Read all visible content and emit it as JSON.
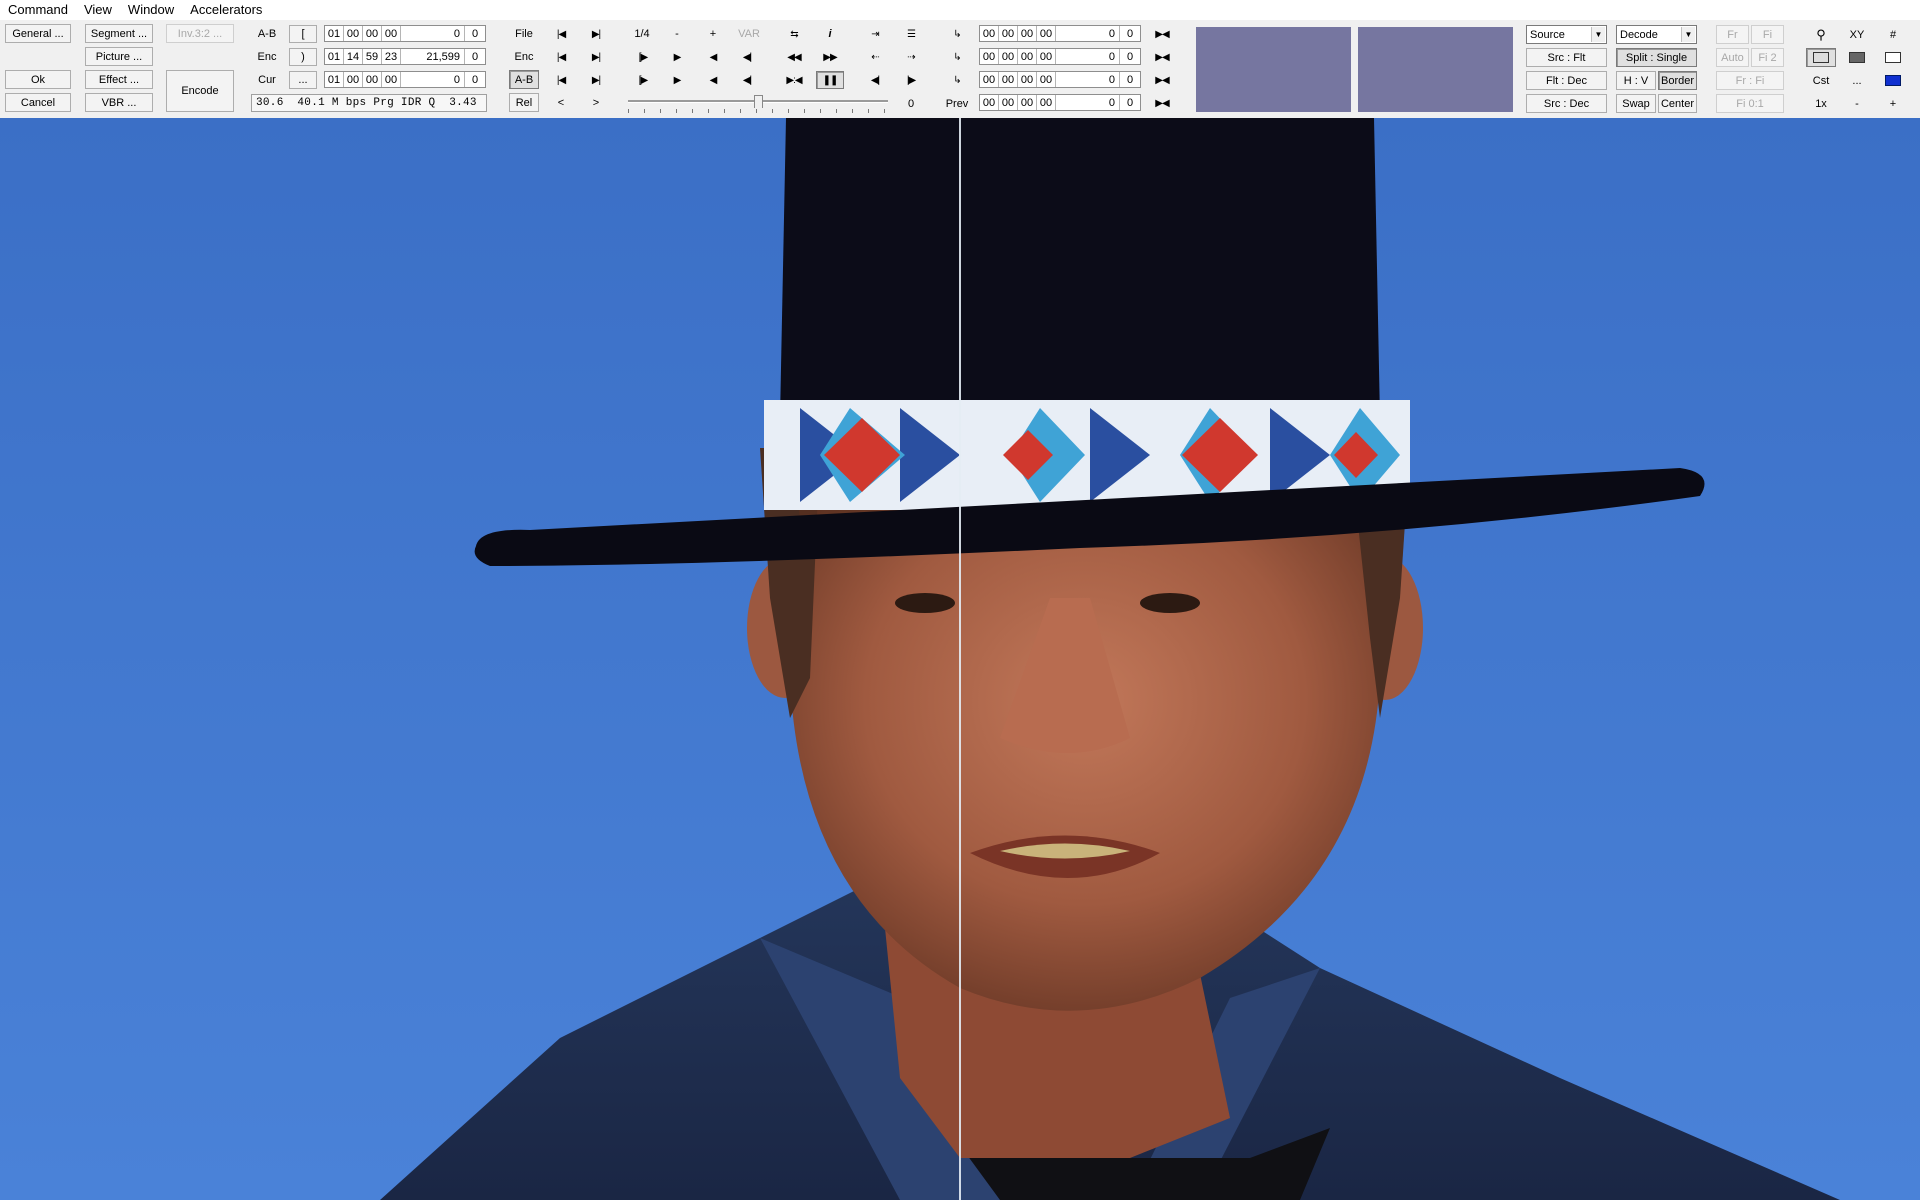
{
  "menu": [
    "Command",
    "View",
    "Window",
    "Accelerators"
  ],
  "left_buttons": {
    "general": "General ...",
    "segment": "Segment ...",
    "inv": "Inv.3:2 ...",
    "picture": "Picture ...",
    "ok": "Ok",
    "effect": "Effect ...",
    "cancel": "Cancel",
    "vbr": "VBR ...",
    "encode": "Encode"
  },
  "range": {
    "ab_label": "A-B",
    "enc_label": "Enc",
    "cur_label": "Cur",
    "mark_in": "[",
    "mark_out": ")",
    "mark_cur": "...",
    "rows": [
      {
        "h": "01",
        "m": "00",
        "s": "00",
        "f": "00",
        "frames": "0",
        "z": "0"
      },
      {
        "h": "01",
        "m": "14",
        "s": "59",
        "f": "23",
        "frames": "21,599",
        "z": "0"
      },
      {
        "h": "01",
        "m": "00",
        "s": "00",
        "f": "00",
        "frames": "0",
        "z": "0"
      }
    ],
    "status": "30.6  40.1 M bps Prg IDR Q  3.43"
  },
  "nav": {
    "file": "File",
    "enc": "Enc",
    "ab": "A-B",
    "rel": "Rel",
    "rel_prev": "<",
    "rel_next": ">",
    "fraction": "1/4",
    "minus": "-",
    "plus": "+",
    "var": "VAR",
    "slider_value": "0",
    "slider_fraction": 0.5
  },
  "right_tc": {
    "prev_label": "Prev",
    "rows": [
      {
        "h": "00",
        "m": "00",
        "s": "00",
        "f": "00",
        "frames": "0",
        "z": "0"
      },
      {
        "h": "00",
        "m": "00",
        "s": "00",
        "f": "00",
        "frames": "0",
        "z": "0"
      },
      {
        "h": "00",
        "m": "00",
        "s": "00",
        "f": "00",
        "frames": "0",
        "z": "0"
      },
      {
        "h": "00",
        "m": "00",
        "s": "00",
        "f": "00",
        "frames": "0",
        "z": "0"
      }
    ]
  },
  "swatch_color": "#7676a0",
  "view_controls": {
    "source_select": "Source",
    "decode_select": "Decode",
    "src_flt": "Src : Flt",
    "split_single": "Split : Single",
    "flt_dec": "Flt : Dec",
    "hv": "H : V",
    "border": "Border",
    "src_dec": "Src : Dec",
    "swap": "Swap",
    "center": "Center",
    "fr": "Fr",
    "fi": "Fi",
    "auto": "Auto",
    "fi2": "Fi 2",
    "fr_fi": "Fr : Fi",
    "fi01": "Fi 0:1",
    "xy": "XY",
    "hash": "#",
    "cst": "Cst",
    "dots": "...",
    "zoom": "1x",
    "zoom_minus": "-",
    "zoom_plus": "+"
  },
  "viewport": {
    "background": "#3a6fc9",
    "split": "vertical"
  }
}
